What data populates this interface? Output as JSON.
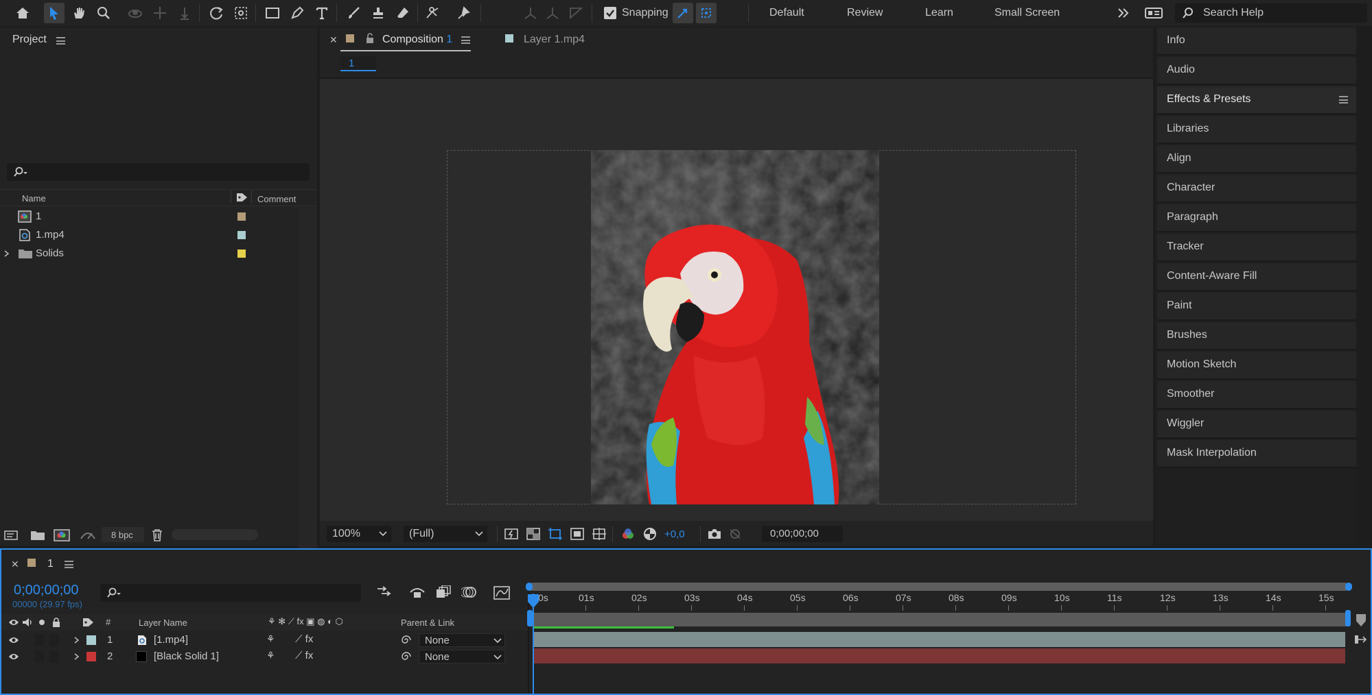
{
  "toolbar": {
    "snapping_label": "Snapping",
    "workspaces": [
      "Default",
      "Review",
      "Learn",
      "Small Screen"
    ],
    "search_placeholder": "Search Help",
    "accent": "#2d8ceb"
  },
  "project": {
    "title": "Project",
    "columns": {
      "name": "Name",
      "comment": "Comment"
    },
    "items": [
      {
        "name": "1",
        "icon": "composition-icon",
        "color": "#b39b77"
      },
      {
        "name": "1.mp4",
        "icon": "footage-icon",
        "color": "#a9cdd0"
      },
      {
        "name": "Solids",
        "icon": "folder-icon",
        "color": "#e6d14a"
      }
    ],
    "bpc": "8 bpc"
  },
  "viewer": {
    "tabs": [
      {
        "label": "Composition",
        "suffix": "1"
      },
      {
        "label": "Layer 1.mp4"
      }
    ],
    "breadcrumb": "1",
    "zoom": "100%",
    "resolution": "(Full)",
    "exposure": "+0,0",
    "timecode": "0;00;00;00"
  },
  "right_panel": {
    "items": [
      "Info",
      "Audio",
      "Effects & Presets",
      "Libraries",
      "Align",
      "Character",
      "Paragraph",
      "Tracker",
      "Content-Aware Fill",
      "Paint",
      "Brushes",
      "Motion Sketch",
      "Smoother",
      "Wiggler",
      "Mask Interpolation"
    ]
  },
  "timeline": {
    "comp_name": "1",
    "timecode": "0;00;00;00",
    "frame_info": "00000 (29.97 fps)",
    "columns": {
      "num": "#",
      "layer_name": "Layer Name",
      "parent": "Parent & Link"
    },
    "ruler": [
      "0s",
      "01s",
      "02s",
      "03s",
      "04s",
      "05s",
      "06s",
      "07s",
      "08s",
      "09s",
      "10s",
      "11s",
      "12s",
      "13s",
      "14s",
      "15s"
    ],
    "layers": [
      {
        "num": "1",
        "name": "[1.mp4]",
        "label_color": "#a9cdd0",
        "parent": "None",
        "bar_color": "#7f8f8f"
      },
      {
        "num": "2",
        "name": "[Black Solid 1]",
        "label_color": "#c83737",
        "parent": "None",
        "bar_color": "#7d3535"
      }
    ]
  }
}
